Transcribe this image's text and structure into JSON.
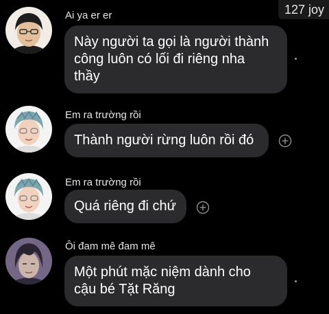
{
  "badge": {
    "text": "127 joy"
  },
  "messages": [
    {
      "sender": "Ai ya er er",
      "lines": [
        "Này người ta gọi là người thành",
        "công luôn có lối đi riêng nha",
        "thầy"
      ]
    },
    {
      "sender": "Em ra trường rồi",
      "lines": [
        "Thành người rừng luôn rồi đó"
      ]
    },
    {
      "sender": "Em ra trường rồi",
      "lines": [
        "Quá riêng đi chứ"
      ]
    },
    {
      "sender": "Ôi đam mê đam mê",
      "lines": [
        "Một phút mặc niệm dành cho",
        "cậu bé Tặt Răng"
      ]
    }
  ],
  "icons": {
    "plus": "add-reaction-icon",
    "dot": "more-options-dot-icon"
  }
}
